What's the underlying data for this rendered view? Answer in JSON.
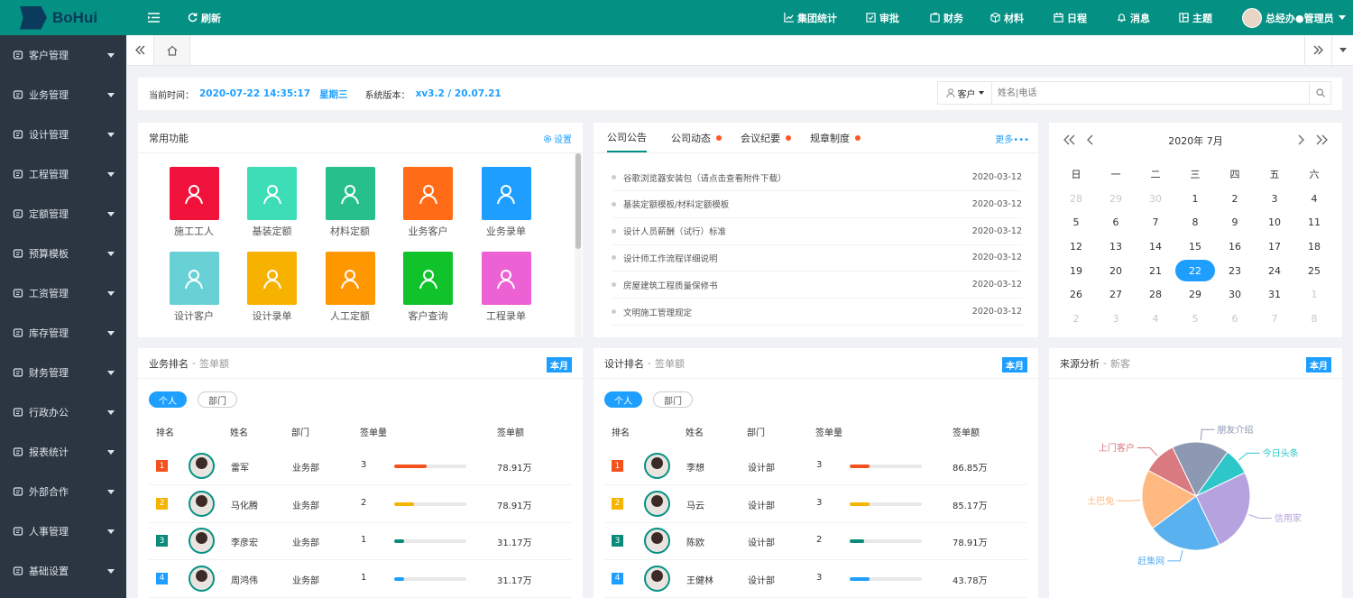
{
  "header": {
    "brand": "BoHui",
    "refresh": "刷新",
    "nav": [
      "集团统计",
      "审批",
      "财务",
      "材料",
      "日程",
      "消息",
      "主题"
    ],
    "user": "总经办●管理员"
  },
  "sidebar": {
    "items": [
      "客户管理",
      "业务管理",
      "设计管理",
      "工程管理",
      "定额管理",
      "预算模板",
      "工资管理",
      "库存管理",
      "财务管理",
      "行政办公",
      "报表统计",
      "外部合作",
      "人事管理",
      "基础设置"
    ]
  },
  "info": {
    "time_label": "当前时间：",
    "time_value": "2020-07-22 14:35:17",
    "weekday": "星期三",
    "version_label": "系统版本：",
    "version_value": "xv3.2 / 20.07.21",
    "search_type": "客户",
    "search_placeholder": "姓名|电话"
  },
  "functions": {
    "title": "常用功能",
    "settings": "设置",
    "items": [
      "施工工人",
      "基装定额",
      "材料定额",
      "业务客户",
      "业务录单",
      "设计客户",
      "设计录单",
      "人工定额",
      "客户查询",
      "工程录单"
    ]
  },
  "notice": {
    "tabs": [
      "公司公告",
      "公司动态",
      "会议纪要",
      "规章制度"
    ],
    "more": "更多•••",
    "items": [
      {
        "title": "谷歌浏览器安装包（请点击查看附件下载）",
        "date": "2020-03-12"
      },
      {
        "title": "基装定额模板/材料定额模板",
        "date": "2020-03-12"
      },
      {
        "title": "设计人员薪酬（试行）标准",
        "date": "2020-03-12"
      },
      {
        "title": "设计师工作流程详细说明",
        "date": "2020-03-12"
      },
      {
        "title": "房屋建筑工程质量保修书",
        "date": "2020-03-12"
      },
      {
        "title": "文明施工管理规定",
        "date": "2020-03-12"
      }
    ]
  },
  "calendar": {
    "title": "2020年  7月",
    "weekdays": [
      "日",
      "一",
      "二",
      "三",
      "四",
      "五",
      "六"
    ],
    "days": [
      [
        "28",
        "29",
        "30",
        "1",
        "2",
        "3",
        "4"
      ],
      [
        "5",
        "6",
        "7",
        "8",
        "9",
        "10",
        "11"
      ],
      [
        "12",
        "13",
        "14",
        "15",
        "16",
        "17",
        "18"
      ],
      [
        "19",
        "20",
        "21",
        "22",
        "23",
        "24",
        "25"
      ],
      [
        "26",
        "27",
        "28",
        "29",
        "30",
        "31",
        "1"
      ],
      [
        "2",
        "3",
        "4",
        "5",
        "6",
        "7",
        "8"
      ]
    ],
    "selected": "22"
  },
  "biz_rank": {
    "title": "业务排名",
    "sub": "签单额",
    "badge": "本月",
    "tab_personal": "个人",
    "tab_dept": "部门",
    "headers": [
      "排名",
      "姓名",
      "部门",
      "签单量",
      "签单额"
    ],
    "rows": [
      {
        "rank": "1",
        "name": "雷军",
        "dept": "业务部",
        "count": "3",
        "amount": "78.91万",
        "pct": 0.45,
        "color": "#f4511e",
        "rcolor": "#f4511e"
      },
      {
        "rank": "2",
        "name": "马化腾",
        "dept": "业务部",
        "count": "2",
        "amount": "78.91万",
        "pct": 0.28,
        "color": "#f5b400",
        "rcolor": "#f5b400"
      },
      {
        "rank": "3",
        "name": "李彦宏",
        "dept": "业务部",
        "count": "1",
        "amount": "31.17万",
        "pct": 0.14,
        "color": "#0c8a79",
        "rcolor": "#0c8a79"
      },
      {
        "rank": "4",
        "name": "周鸿伟",
        "dept": "业务部",
        "count": "1",
        "amount": "31.17万",
        "pct": 0.14,
        "color": "#1e9fff",
        "rcolor": "#1e9fff"
      }
    ]
  },
  "design_rank": {
    "title": "设计排名",
    "sub": "签单额",
    "badge": "本月",
    "tab_personal": "个人",
    "tab_dept": "部门",
    "headers": [
      "排名",
      "姓名",
      "部门",
      "签单量",
      "签单额"
    ],
    "rows": [
      {
        "rank": "1",
        "name": "李想",
        "dept": "设计部",
        "count": "3",
        "amount": "86.85万",
        "pct": 0.28,
        "color": "#f4511e",
        "rcolor": "#f4511e"
      },
      {
        "rank": "2",
        "name": "马云",
        "dept": "设计部",
        "count": "3",
        "amount": "85.17万",
        "pct": 0.28,
        "color": "#f5b400",
        "rcolor": "#f5b400"
      },
      {
        "rank": "3",
        "name": "陈欧",
        "dept": "设计部",
        "count": "2",
        "amount": "78.91万",
        "pct": 0.2,
        "color": "#0c8a79",
        "rcolor": "#0c8a79"
      },
      {
        "rank": "4",
        "name": "王健林",
        "dept": "设计部",
        "count": "3",
        "amount": "43.78万",
        "pct": 0.28,
        "color": "#1e9fff",
        "rcolor": "#1e9fff"
      }
    ]
  },
  "source": {
    "title": "来源分析",
    "sub": "新客",
    "badge": "本月"
  },
  "chart_data": {
    "type": "pie",
    "slices": [
      {
        "label": "今日头条",
        "value": 8,
        "color": "#2ec7c9"
      },
      {
        "label": "信用家",
        "value": 25,
        "color": "#b6a2de"
      },
      {
        "label": "赶集网",
        "value": 22,
        "color": "#5ab1ef"
      },
      {
        "label": "土巴兔",
        "value": 18,
        "color": "#ffb980"
      },
      {
        "label": "上门客户",
        "value": 10,
        "color": "#d87a80"
      },
      {
        "label": "朋友介绍",
        "value": 17,
        "color": "#8d98b3"
      }
    ]
  }
}
